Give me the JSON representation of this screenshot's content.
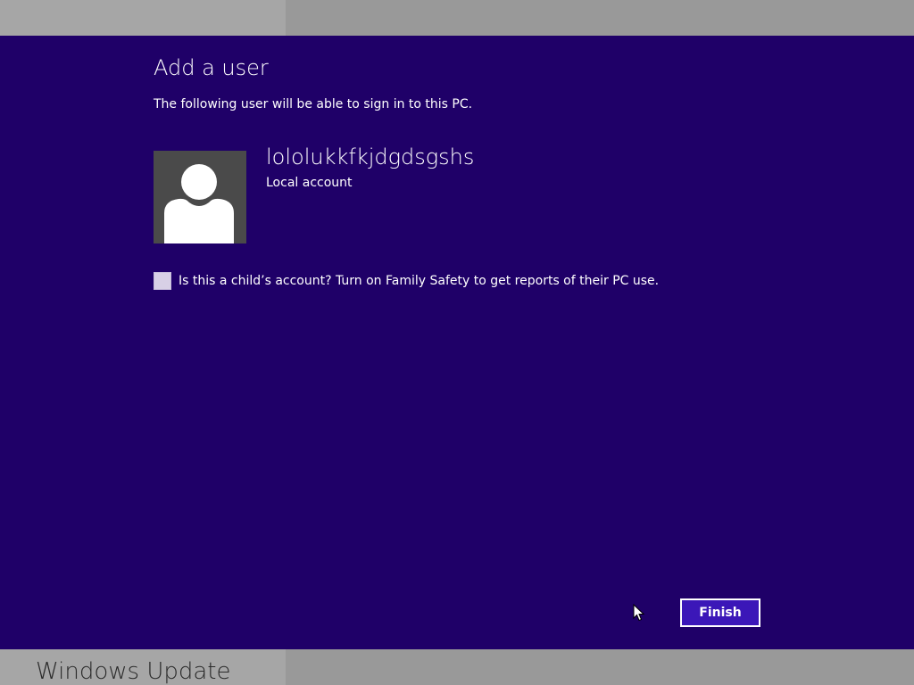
{
  "background_app": {
    "title": "Windows Update"
  },
  "dialog": {
    "title": "Add a user",
    "subtitle": "The following user will be able to sign in to this PC.",
    "user": {
      "name": "lololukkfkjdgdsgshs",
      "account_type": "Local account",
      "avatar_icon": "user-silhouette-icon"
    },
    "child_account": {
      "label": "Is this a child’s account? Turn on Family Safety to get reports of their PC use.",
      "checked": false
    },
    "finish_label": "Finish"
  },
  "colors": {
    "dialog_background": "#1f0068",
    "button_background": "#3b17b8",
    "text": "#ffffff",
    "avatar_background": "#4a4a4a"
  }
}
